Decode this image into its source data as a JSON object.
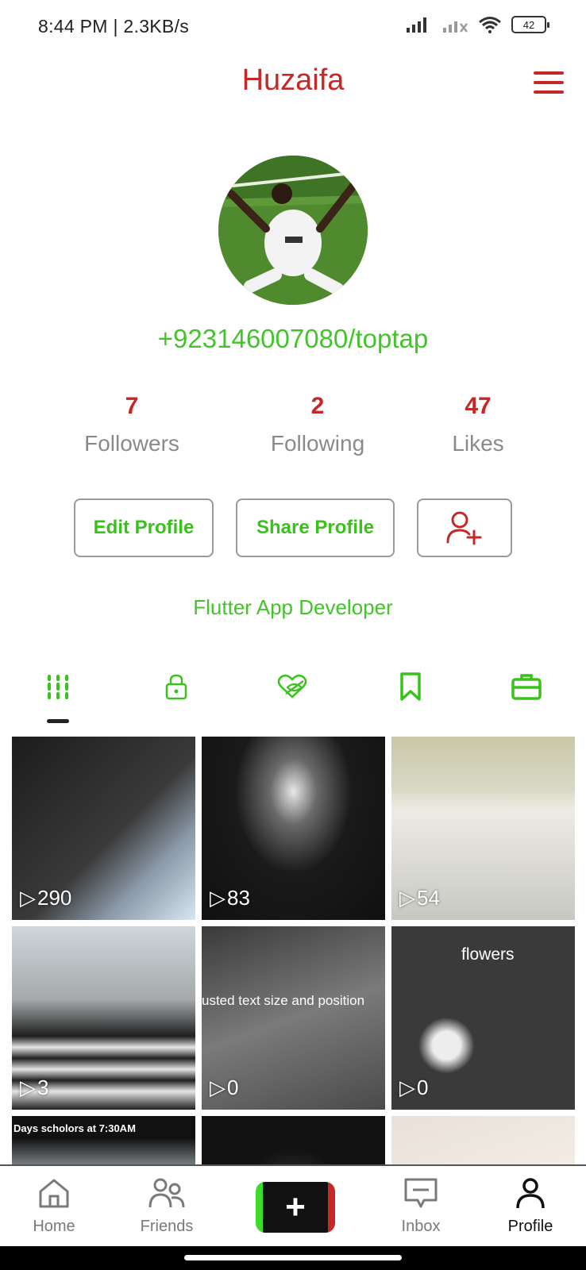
{
  "status": {
    "time": "8:44 PM | 2.3KB/s",
    "battery": "42"
  },
  "header": {
    "title": "Huzaifa"
  },
  "profile": {
    "username": "+923146007080/toptap",
    "bio": "Flutter App Developer",
    "stats": [
      {
        "value": "7",
        "label": "Followers"
      },
      {
        "value": "2",
        "label": "Following"
      },
      {
        "value": "47",
        "label": "Likes"
      }
    ],
    "buttons": {
      "edit": "Edit Profile",
      "share": "Share Profile"
    }
  },
  "tabs": [
    {
      "icon": "grid-icon",
      "active": true
    },
    {
      "icon": "lock-icon",
      "active": false
    },
    {
      "icon": "heart-hidden-icon",
      "active": false
    },
    {
      "icon": "bookmark-icon",
      "active": false
    },
    {
      "icon": "briefcase-icon",
      "active": false
    }
  ],
  "videos": [
    {
      "views": "290",
      "caption": ""
    },
    {
      "views": "83",
      "caption": ""
    },
    {
      "views": "54",
      "caption": ""
    },
    {
      "views": "3",
      "caption": ""
    },
    {
      "views": "0",
      "caption": "usted text size and position"
    },
    {
      "views": "0",
      "caption": "flowers"
    },
    {
      "views": "",
      "caption": "Days scholors at 7:30AM"
    }
  ],
  "nav": {
    "home": "Home",
    "friends": "Friends",
    "inbox": "Inbox",
    "profile": "Profile"
  },
  "colors": {
    "accent_red": "#c62828",
    "accent_green": "#44c42b"
  }
}
